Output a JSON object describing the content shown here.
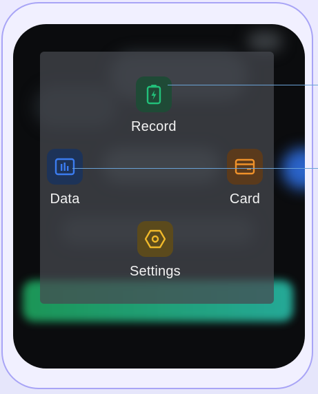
{
  "menu": {
    "items": [
      {
        "label": "Record",
        "icon": "battery-icon",
        "color": "#22c07a"
      },
      {
        "label": "Data",
        "icon": "bar-chart-icon",
        "color": "#3b7cf0"
      },
      {
        "label": "Card",
        "icon": "card-icon",
        "color": "#f0922a"
      },
      {
        "label": "Settings",
        "icon": "hexagon-settings-icon",
        "color": "#f0b92a"
      }
    ]
  },
  "colors": {
    "frame": "#a8a4f6",
    "screen": "#0b0c0e",
    "accent_green": "#22c07a"
  }
}
